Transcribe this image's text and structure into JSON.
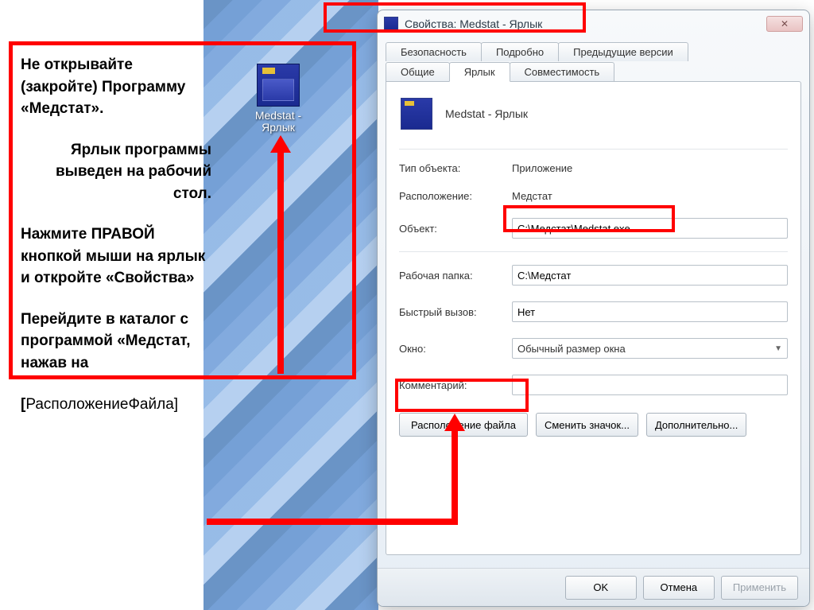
{
  "instructions": {
    "p1": "Не открывайте (закройте) Программу «Медстат».",
    "p2": "Ярлык программы выведен на рабочий стол.",
    "p3": "Нажмите ПРАВОЙ кнопкой мыши на ярлык и откройте «Свойства»",
    "p4": "Перейдите в каталог с программой «Медстат, нажав на",
    "p5_prefix": "[",
    "p5_rest": "РасположениеФайла]"
  },
  "desktop_icon_label": "Medstat - Ярлык",
  "dialog": {
    "title": "Свойства: Medstat - Ярлык",
    "close_glyph": "✕",
    "tabs_row1": [
      "Безопасность",
      "Подробно",
      "Предыдущие версии"
    ],
    "tabs_row2": [
      "Общие",
      "Ярлык",
      "Совместимость"
    ],
    "active_tab": "Ярлык",
    "item_name": "Medstat - Ярлык",
    "labels": {
      "type": "Тип объекта:",
      "location": "Расположение:",
      "target": "Объект:",
      "startin": "Рабочая папка:",
      "hotkey": "Быстрый вызов:",
      "run": "Окно:",
      "comment": "Комментарий:"
    },
    "values": {
      "type": "Приложение",
      "location": "Медстат",
      "target": "C:\\Медстат\\Medstat.exe",
      "startin": "C:\\Медстат",
      "hotkey": "Нет",
      "run": "Обычный размер окна",
      "comment": ""
    },
    "buttons": {
      "open_location": "Расположение файла",
      "change_icon": "Сменить значок...",
      "advanced": "Дополнительно...",
      "ok": "OK",
      "cancel": "Отмена",
      "apply": "Применить"
    }
  }
}
